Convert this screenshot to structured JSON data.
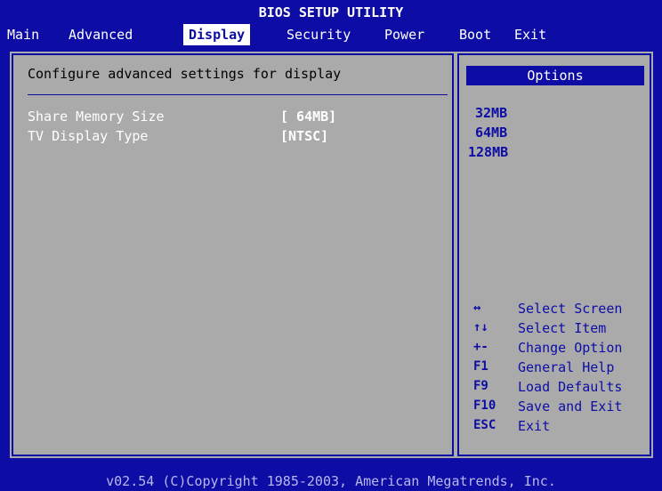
{
  "title": "BIOS SETUP UTILITY",
  "menu": [
    {
      "label": "Main"
    },
    {
      "label": "Advanced"
    },
    {
      "label": "Display",
      "active": true
    },
    {
      "label": "Security"
    },
    {
      "label": "Power"
    },
    {
      "label": "Boot"
    },
    {
      "label": "Exit"
    }
  ],
  "left": {
    "heading": "Configure advanced settings for display",
    "settings": [
      {
        "label": "Share Memory Size",
        "value": "[ 64MB]"
      },
      {
        "label": "TV Display Type",
        "value": "[NTSC]"
      }
    ]
  },
  "right": {
    "options_title": "Options",
    "options": [
      "32MB",
      "64MB",
      "128MB"
    ],
    "help": [
      {
        "key": "↔",
        "desc": "Select Screen"
      },
      {
        "key": "↑↓",
        "desc": "Select Item"
      },
      {
        "key": "+-",
        "desc": "Change Option"
      },
      {
        "key": "F1",
        "desc": "General Help"
      },
      {
        "key": "F9",
        "desc": "Load Defaults"
      },
      {
        "key": "F10",
        "desc": "Save and Exit"
      },
      {
        "key": "ESC",
        "desc": "Exit"
      }
    ]
  },
  "footer": "v02.54 (C)Copyright 1985-2003, American Megatrends, Inc.",
  "colors": {
    "background": "#0d0da6",
    "panel": "#aaaaaa",
    "highlight": "#ffffff"
  }
}
